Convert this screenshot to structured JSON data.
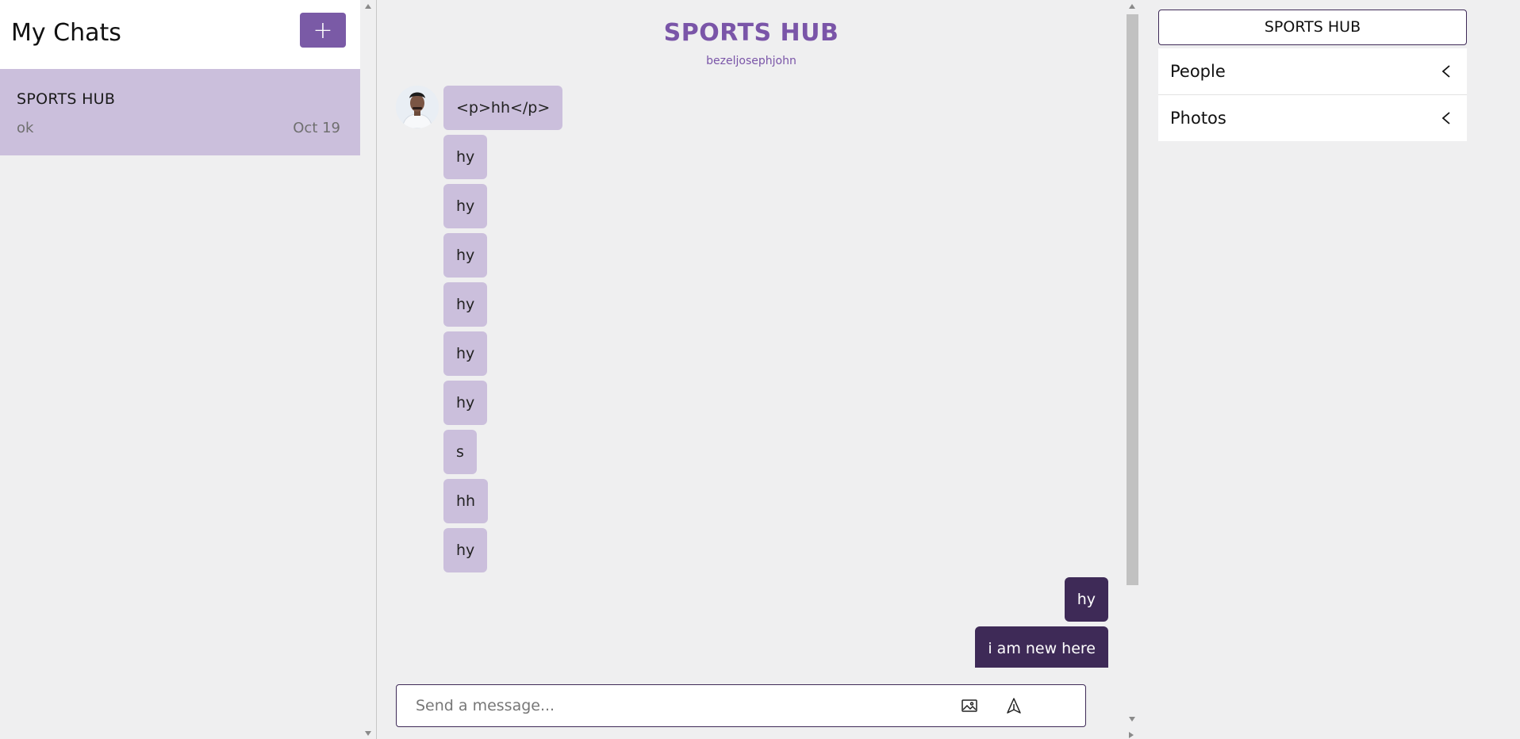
{
  "sidebar": {
    "title": "My Chats",
    "new_chat_label": "+",
    "chats": [
      {
        "name": "SPORTS HUB",
        "last_message": "ok",
        "date": "Oct 19"
      }
    ]
  },
  "chat": {
    "title": "SPORTS HUB",
    "subtitle": "bezeljosephjohn",
    "messages_in": [
      "<p>hh</p>",
      "hy",
      "hy",
      "hy",
      "hy",
      "hy",
      "hy",
      "s",
      "hh",
      "hy"
    ],
    "messages_out": [
      "hy",
      "i am new here"
    ],
    "input_placeholder": "Send a message..."
  },
  "details": {
    "name": "SPORTS HUB",
    "sections": [
      "People",
      "Photos"
    ]
  },
  "colors": {
    "accent": "#7a5aa6",
    "incoming_bubble": "#cbbfdc",
    "outgoing_bubble": "#3e2a57",
    "background": "#efeff0"
  },
  "icons": {
    "image": "image-icon",
    "send": "send-icon",
    "collapse": "chevron-left-icon"
  }
}
